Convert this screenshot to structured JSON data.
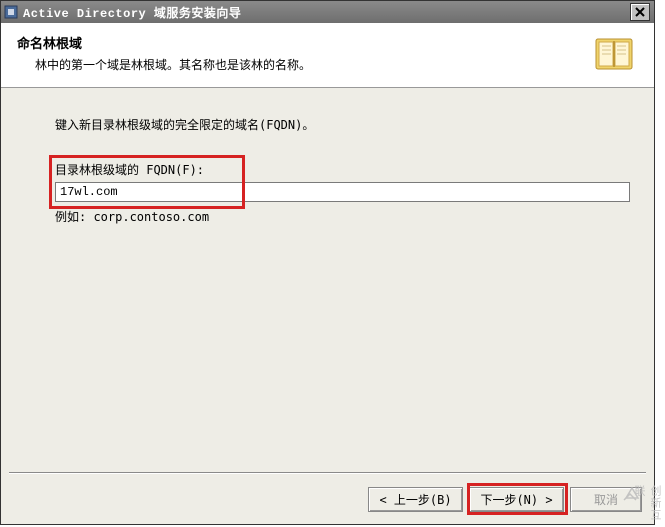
{
  "titlebar": {
    "title": "Active Directory 域服务安装向导",
    "close_label": "✕"
  },
  "header": {
    "title": "命名林根域",
    "subtitle": "林中的第一个域是林根域。其名称也是该林的名称。"
  },
  "content": {
    "instruction": "键入新目录林根级域的完全限定的域名(FQDN)。",
    "field_label": "目录林根级域的 FQDN(F):",
    "field_value": "17wl.com",
    "field_example": "例如: corp.contoso.com"
  },
  "footer": {
    "back_label": "< 上一步(B)",
    "next_label": "下一步(N) >",
    "cancel_label": "取消"
  },
  "watermark": {
    "text": "创新互联"
  }
}
